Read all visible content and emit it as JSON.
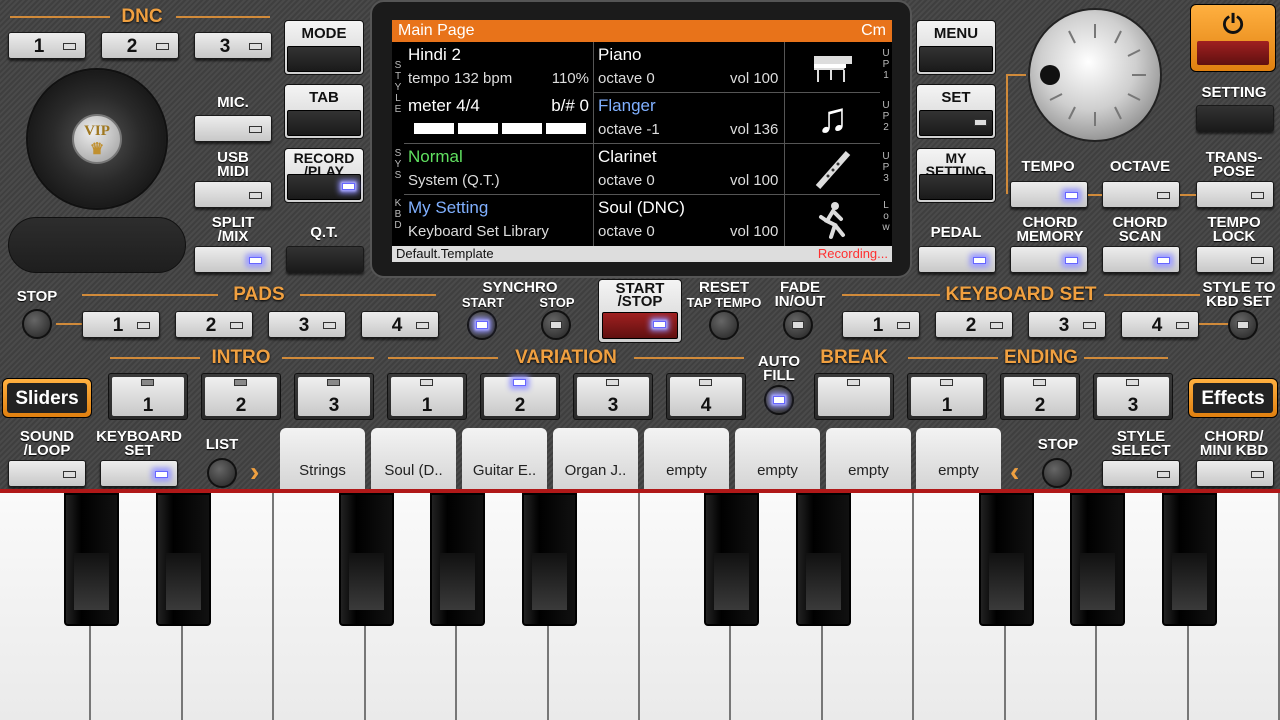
{
  "dnc": {
    "title": "DNC",
    "buttons": [
      "1",
      "2",
      "3"
    ]
  },
  "left": {
    "mic": "MIC.",
    "usb_midi": "USB\nMIDI",
    "split_mix": "SPLIT\n/MIX",
    "vip": "VIP"
  },
  "mode_col": {
    "mode": "MODE",
    "tab": "TAB",
    "record_play": "RECORD\n/PLAY",
    "qt": "Q.T."
  },
  "menu_col": {
    "menu": "MENU",
    "set": "SET",
    "my_setting": "MY\nSETTING",
    "pedal": "PEDAL"
  },
  "right": {
    "setting": "SETTING",
    "tempo": "TEMPO",
    "octave": "OCTAVE",
    "transpose": "TRANS-\nPOSE",
    "chord_memory": "CHORD\nMEMORY",
    "chord_scan": "CHORD\nSCAN",
    "tempo_lock": "TEMPO\nLOCK"
  },
  "display": {
    "header": "Main Page",
    "key": "Cm",
    "side_labels": {
      "style": "STYLE",
      "sys": "SYS",
      "kbd": "KBD"
    },
    "right_labels": {
      "up1": "UP1",
      "up2": "UP2",
      "up3": "UP3",
      "low": "Low"
    },
    "style_name": "Hindi 2",
    "tempo": "tempo 132 bpm",
    "tempo_pct": "110%",
    "meter": "meter 4/4",
    "bsharp": "b/# 0",
    "sys_name": "Normal",
    "sys_sub": "System (Q.T.)",
    "kbd_name": "My Setting",
    "kbd_sub": "Keyboard Set Library",
    "parts": [
      {
        "name": "Piano",
        "octave": "octave 0",
        "vol": "vol 100",
        "icon": "piano-icon"
      },
      {
        "name": "Flanger",
        "octave": "octave -1",
        "vol": "vol 136",
        "icon": "music-note-icon"
      },
      {
        "name": "Clarinet",
        "octave": "octave 0",
        "vol": "vol 100",
        "icon": "clarinet-icon"
      },
      {
        "name": "Soul (DNC)",
        "octave": "octave 0",
        "vol": "vol 100",
        "icon": "dancer-icon"
      }
    ],
    "footer_left": "Default.Template",
    "footer_right": "Recording..."
  },
  "row1": {
    "stop": "STOP",
    "pads": "PADS",
    "pad_buttons": [
      "1",
      "2",
      "3",
      "4"
    ],
    "synchro": "SYNCHRO",
    "start": "START",
    "sync_stop": "STOP",
    "start_stop": "START\n/STOP",
    "reset": "RESET",
    "tap_tempo": "TAP TEMPO",
    "fade": "FADE\nIN/OUT",
    "keyboard_set": "KEYBOARD SET",
    "kbd_buttons": [
      "1",
      "2",
      "3",
      "4"
    ],
    "style_to_kbd": "STYLE TO\nKBD SET"
  },
  "row2": {
    "sliders": "Sliders",
    "intro": "INTRO",
    "intro_buttons": [
      "1",
      "2",
      "3"
    ],
    "variation": "VARIATION",
    "variation_buttons": [
      "1",
      "2",
      "3",
      "4"
    ],
    "auto_fill": "AUTO\nFILL",
    "break": "BREAK",
    "ending": "ENDING",
    "ending_buttons": [
      "1",
      "2",
      "3"
    ],
    "effects": "Effects"
  },
  "row3": {
    "sound_loop": "SOUND\n/LOOP",
    "keyboard_set": "KEYBOARD\nSET",
    "list": "LIST",
    "stop": "STOP",
    "style_select": "STYLE\nSELECT",
    "chord_mini": "CHORD/\nMINI KBD",
    "tabs": [
      "Strings",
      "Soul (D..",
      "Guitar E..",
      "Organ J..",
      "empty",
      "empty",
      "empty",
      "empty"
    ]
  },
  "colors": {
    "accent": "#f0a040",
    "display_header": "#e8731a",
    "sys_green": "#60e060",
    "blue": "#80b0ff",
    "recording": "#ff3030"
  }
}
